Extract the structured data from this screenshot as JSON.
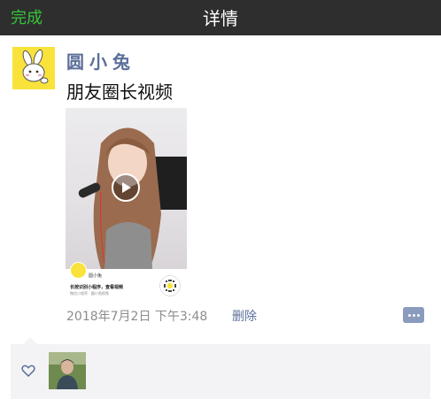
{
  "navbar": {
    "done_label": "完成",
    "title": "详情"
  },
  "post": {
    "username": "圆小兔",
    "text": "朋友圈长视频",
    "card": {
      "name": "圆小兔",
      "line1": "长按识别小程序，查看视频",
      "line2": "微信小程序 · 圆小兔视频"
    },
    "timestamp": "2018年7月2日 下午3:48",
    "delete_label": "删除"
  },
  "colors": {
    "navbar": "#2e2e2e",
    "done": "#35c43a",
    "link": "#5c6f9a",
    "avatar_bg": "#f9e33b",
    "likes_bg": "#f3f3f5"
  },
  "icons": {
    "like": "heart-outline-icon",
    "comment": "comment-more-icon",
    "play": "play-icon"
  }
}
